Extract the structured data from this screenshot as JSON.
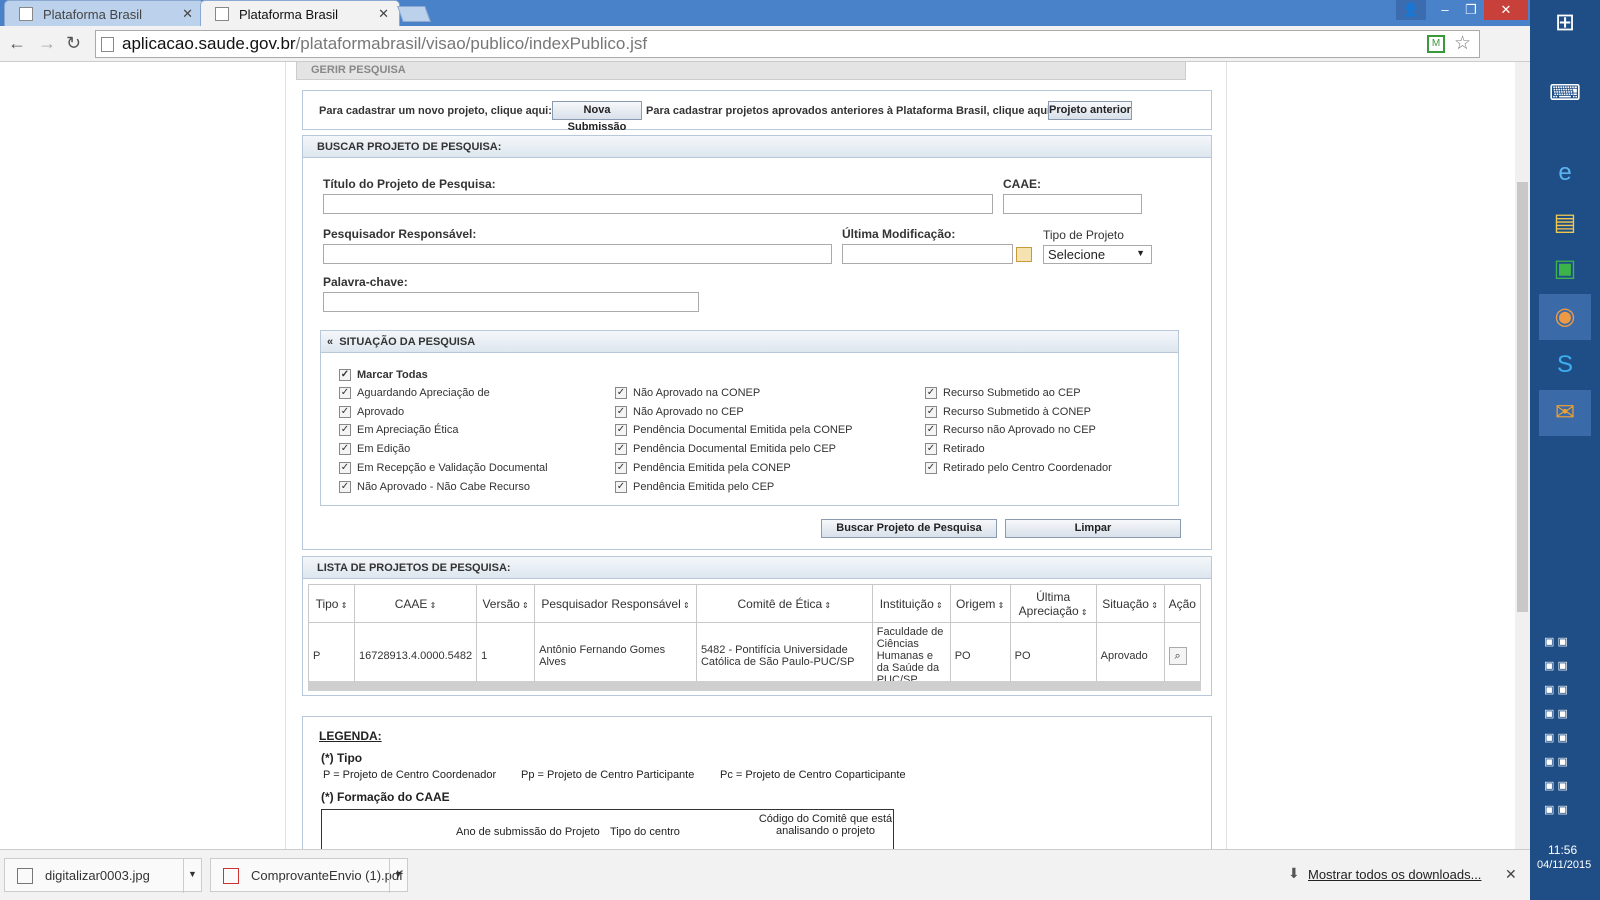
{
  "browser": {
    "tabs": [
      {
        "title": "Plataforma Brasil"
      },
      {
        "title": "Plataforma Brasil"
      }
    ],
    "url_domain": "aplicacao.saude.gov.br",
    "url_path": "/plataformabrasil/visao/publico/indexPublico.jsf"
  },
  "page": {
    "section_title": "GERIR PESQUISA",
    "submission": {
      "text1": "Para cadastrar um novo projeto, clique aqui:",
      "btn1": "Nova Submissão",
      "text2": "Para cadastrar projetos aprovados anteriores à Plataforma Brasil, clique aqui:",
      "btn2": "Projeto anterior"
    },
    "search": {
      "header": "BUSCAR PROJETO DE PESQUISA:",
      "title_label": "Título do Projeto de Pesquisa:",
      "caae_label": "CAAE:",
      "researcher_label": "Pesquisador Responsável:",
      "last_mod_label": "Última Modificação:",
      "type_label": "Tipo de Projeto",
      "type_selected": "Selecione",
      "keyword_label": "Palavra-chave:",
      "status_header": "SITUAÇÃO DA PESQUISA",
      "collapse_glyph": "«",
      "mark_all": "Marcar Todas",
      "col1": [
        "Aguardando Apreciação de",
        "Aprovado",
        "Em Apreciação Ética",
        "Em Edição",
        "Em Recepção e Validação Documental",
        "Não Aprovado - Não Cabe Recurso"
      ],
      "col2": [
        "Não Aprovado na CONEP",
        "Não Aprovado no CEP",
        "Pendência Documental Emitida pela CONEP",
        "Pendência Documental Emitida pelo CEP",
        "Pendência Emitida pela CONEP",
        "Pendência Emitida pelo CEP"
      ],
      "col3": [
        "Recurso Submetido ao CEP",
        "Recurso Submetido à CONEP",
        "Recurso não Aprovado no CEP",
        "Retirado",
        "Retirado pelo Centro Coordenador"
      ],
      "search_btn": "Buscar Projeto de Pesquisa",
      "clear_btn": "Limpar"
    },
    "list": {
      "header": "LISTA DE PROJETOS DE PESQUISA:",
      "columns": [
        "Tipo",
        "CAAE",
        "Versão",
        "Pesquisador Responsável",
        "Comitê de Ética",
        "Instituição",
        "Origem",
        "Última Apreciação",
        "Situação",
        "Ação"
      ],
      "rows": [
        [
          "P",
          "16728913.4.0000.5482",
          "1",
          "Antônio Fernando Gomes Alves",
          "5482 - Pontifícia Universidade Católica de São Paulo-PUC/SP",
          "Faculdade de Ciências Humanas e da Saúde da PUC/SP",
          "PO",
          "PO",
          "Aprovado"
        ]
      ]
    },
    "legend": {
      "title": "LEGENDA:",
      "tipo_title": "(*) Tipo",
      "tipo_p": "P  =  Projeto de Centro Coordenador",
      "tipo_pp": "Pp = Projeto de Centro Participante",
      "tipo_pc": "Pc = Projeto de Centro Coparticipante",
      "caae_title": "(*) Formação do CAAE",
      "caae_col1": "Ano de submissão do Projeto",
      "caae_col2": "Tipo do centro",
      "caae_col3": "Código do Comitê que está analisando o projeto"
    }
  },
  "downloads": {
    "items": [
      "digitalizar0003.jpg",
      "ComprovanteEnvio (1).pdf"
    ],
    "show_all": "Mostrar todos os downloads..."
  },
  "taskbar": {
    "time": "11:56",
    "date": "04/11/2015"
  }
}
